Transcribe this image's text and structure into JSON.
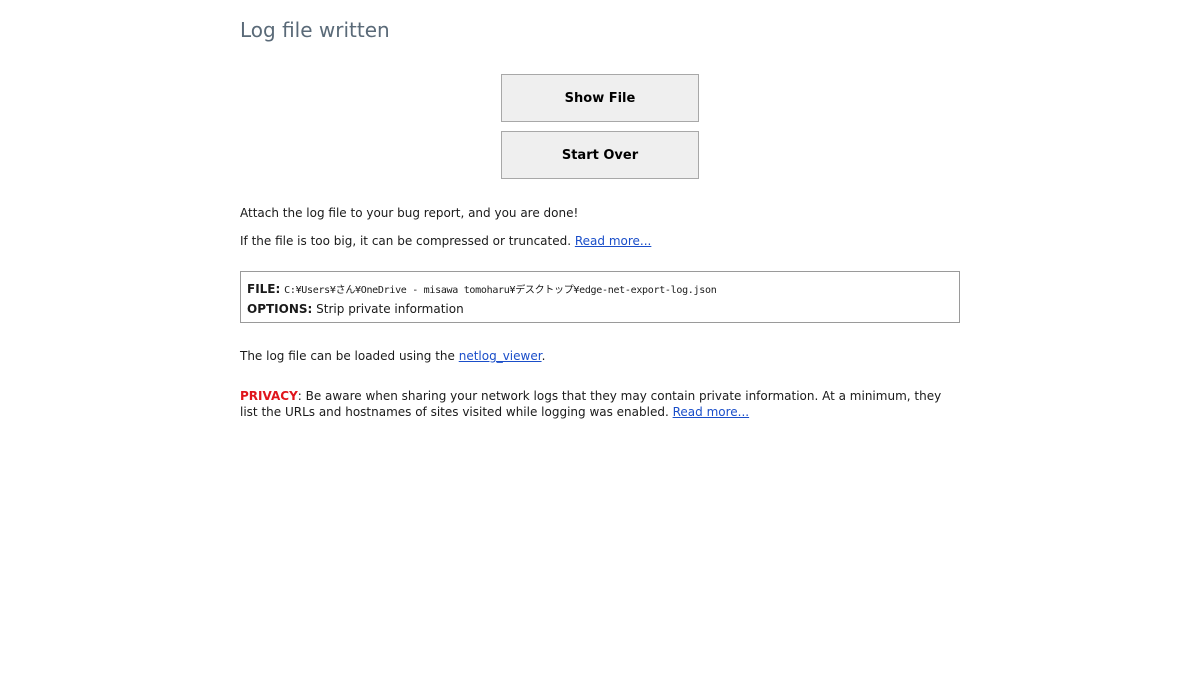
{
  "header": {
    "title": "Log file written"
  },
  "actions": {
    "show_file_label": "Show File",
    "start_over_label": "Start Over"
  },
  "messages": {
    "done": "Attach the log file to your bug report, and you are done!",
    "too_big": "If the file is too big, it can be compressed or truncated. ",
    "too_big_link": "Read more...",
    "viewer_prefix": "The log file can be loaded using the ",
    "viewer_link": "netlog_viewer",
    "viewer_suffix": "."
  },
  "file_info": {
    "file_label": "FILE:",
    "file_path": "C:¥Users¥さん¥OneDrive - misawa tomoharu¥デスクトップ¥edge-net-export-log.json",
    "options_label": "OPTIONS:",
    "options_value": "Strip private information"
  },
  "privacy": {
    "label": "PRIVACY",
    "text": ": Be aware when sharing your network logs that they may contain private information. At a minimum, they list the URLs and hostnames of sites visited while logging was enabled. ",
    "link": "Read more..."
  },
  "colors": {
    "title": "#5a6a78",
    "link": "#1a4ec9",
    "privacy_label": "#e0141b",
    "button_bg": "#efefef",
    "button_border": "#a8a8a8"
  }
}
